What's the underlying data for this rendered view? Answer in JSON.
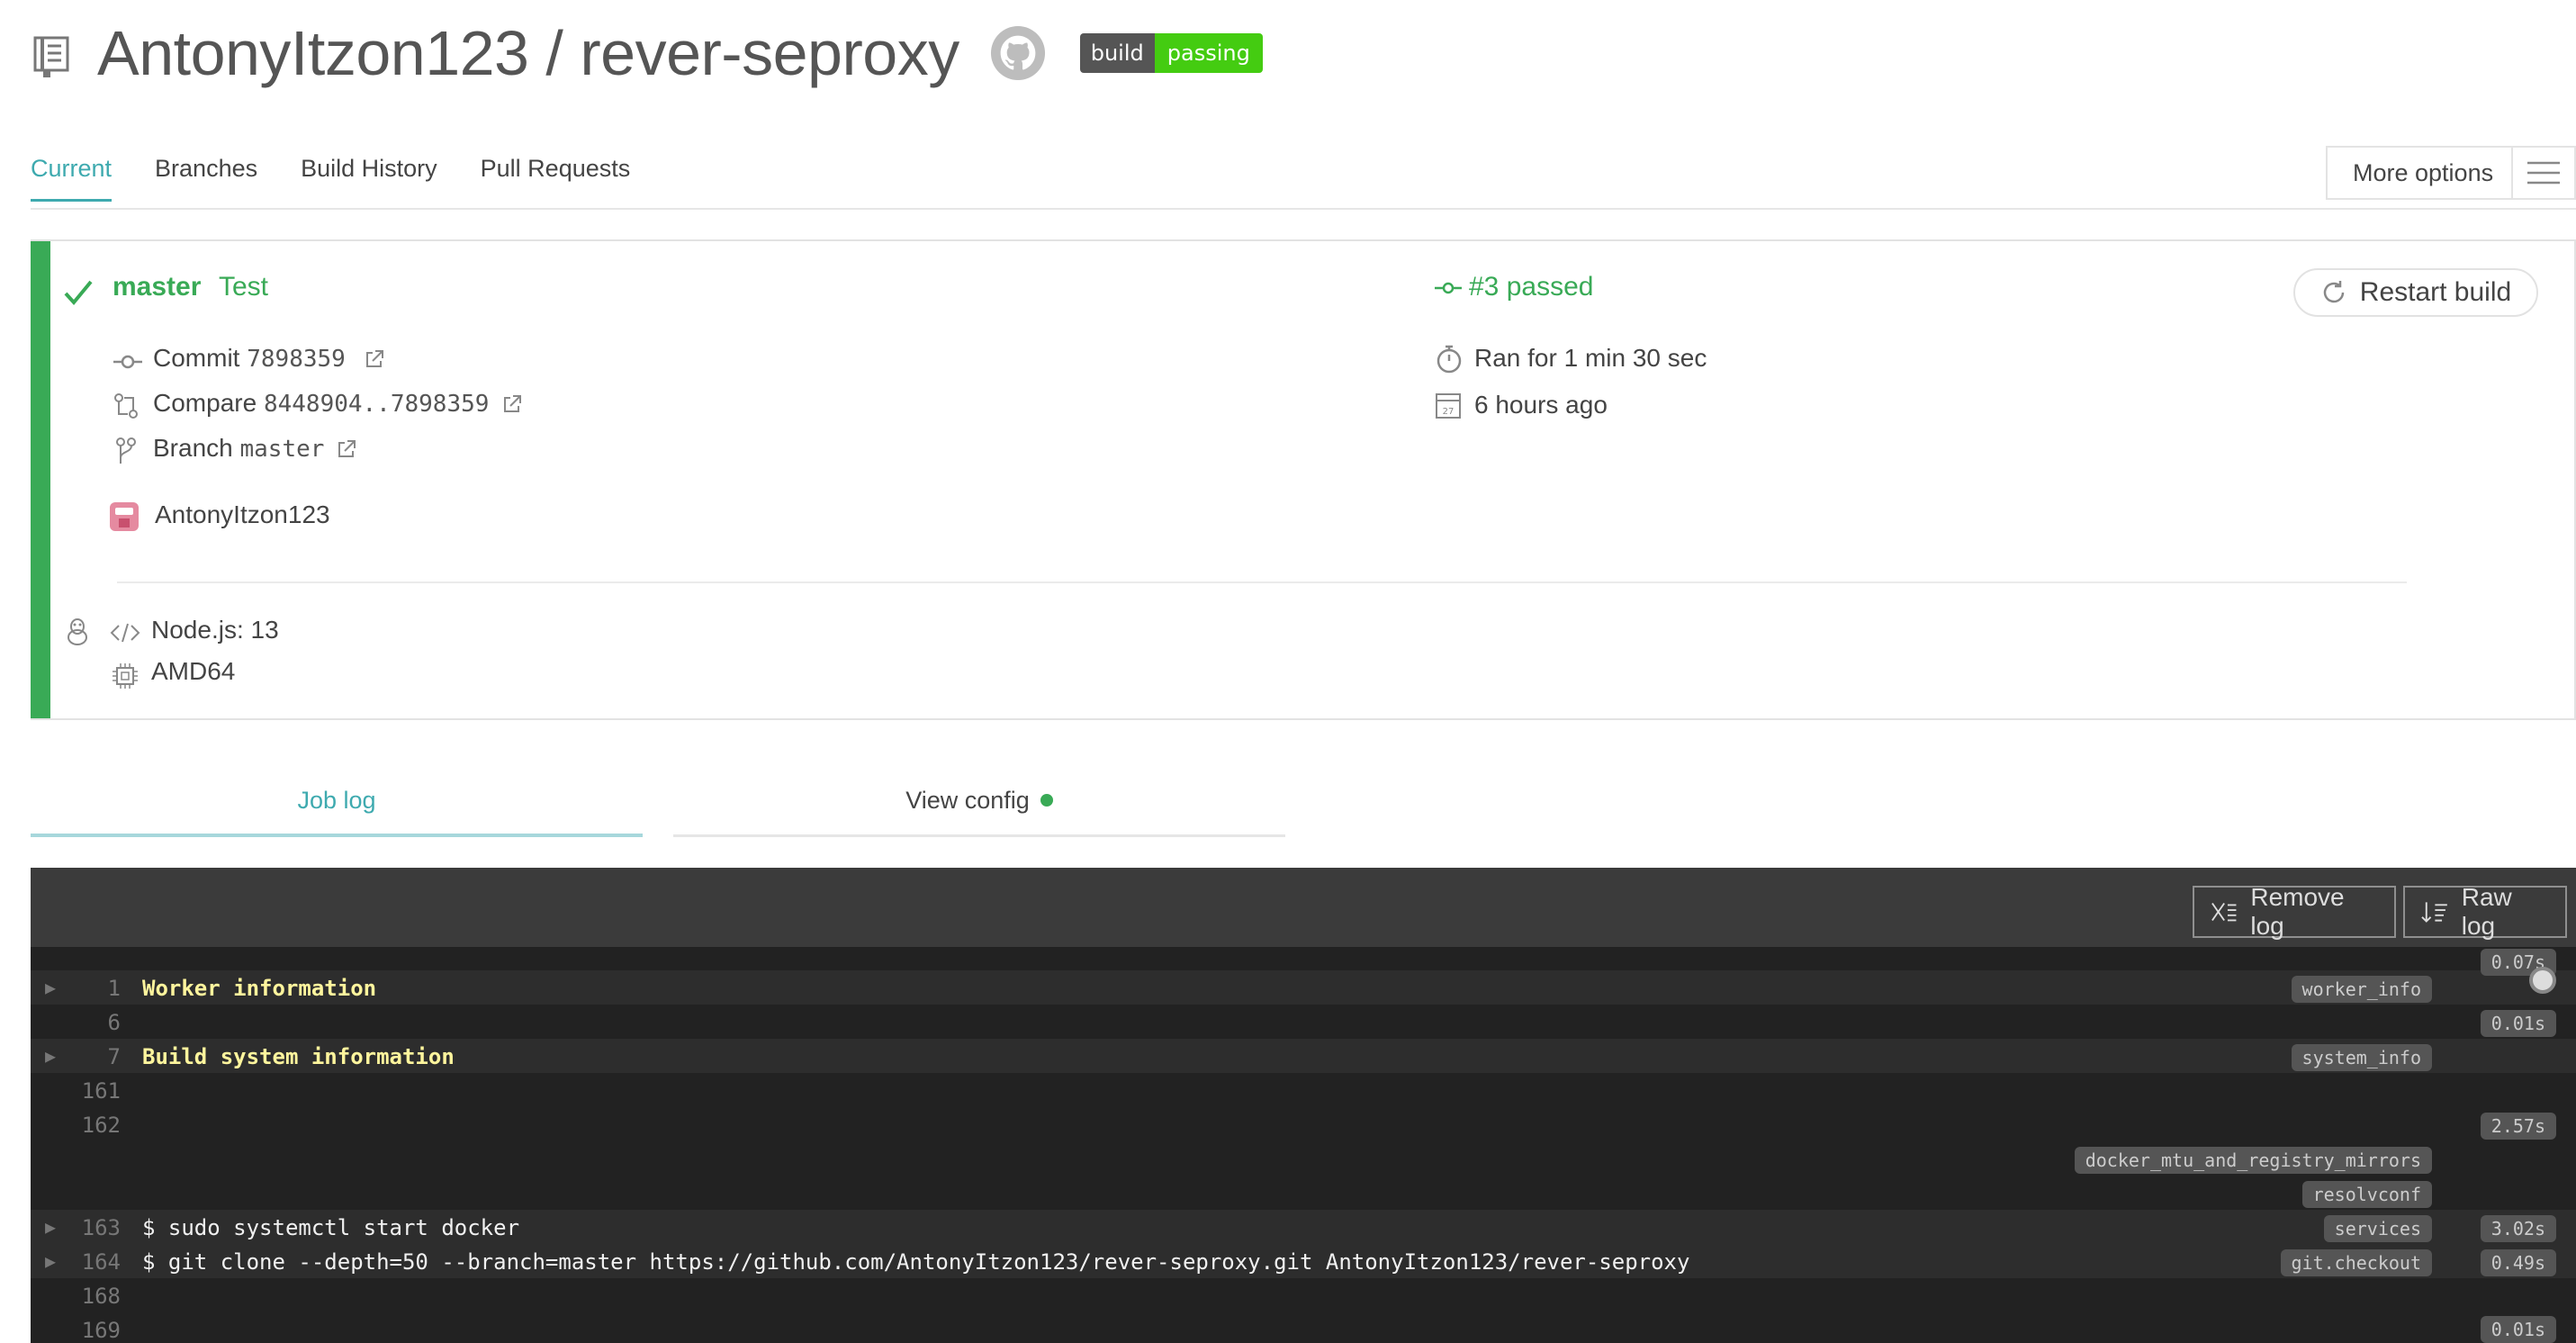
{
  "header": {
    "repo_title": "AntonyItzon123 / rever-seproxy",
    "badge": {
      "left": "build",
      "right": "passing"
    }
  },
  "tabs": [
    {
      "label": "Current",
      "active": true
    },
    {
      "label": "Branches"
    },
    {
      "label": "Build History"
    },
    {
      "label": "Pull Requests"
    }
  ],
  "more_options": {
    "label": "More options"
  },
  "build": {
    "branch": "master",
    "message": "Test",
    "status": "#3 passed",
    "commit_label": "Commit",
    "commit": "7898359",
    "compare_label": "Compare",
    "compare": "8448904..7898359",
    "branch_label": "Branch",
    "branch_value": "master",
    "author": "AntonyItzon123",
    "duration": "Ran for 1 min 30 sec",
    "finished": "6 hours ago",
    "restart_label": "Restart build",
    "language": "Node.js: 13",
    "arch": "AMD64",
    "calendar_day": "27"
  },
  "log_tabs": {
    "job_log": "Job log",
    "view_config": "View config"
  },
  "log_toolbar": {
    "remove": "Remove log",
    "raw": "Raw log"
  },
  "log_lines": [
    {
      "num": "1",
      "text": "Worker information",
      "style": "yellow",
      "fold": true
    },
    {
      "num": "6",
      "text": ""
    },
    {
      "num": "7",
      "text": "Build system information",
      "style": "yellow",
      "fold": true
    },
    {
      "num": "161",
      "text": ""
    },
    {
      "num": "162",
      "text": ""
    },
    {
      "num": "163",
      "text": "$ sudo systemctl start docker",
      "fold": true
    },
    {
      "num": "164",
      "text": "$ git clone --depth=50 --branch=master https://github.com/AntonyItzon123/rever-seproxy.git AntonyItzon123/rever-seproxy",
      "fold": true
    },
    {
      "num": "168",
      "text": ""
    },
    {
      "num": "169",
      "text": ""
    }
  ],
  "log_tags": {
    "worker_info": "worker_info",
    "system_info": "system_info",
    "docker_mtu": "docker_mtu_and_registry_mirrors",
    "resolvconf": "resolvconf",
    "services": "services",
    "git_checkout": "git.checkout"
  },
  "log_times": {
    "t0": "0.07s",
    "t1": "0.01s",
    "t2": "2.57s",
    "t3": "3.02s",
    "t4": "0.49s",
    "t5": "0.01s"
  },
  "colors": {
    "passed_green": "#39aa56",
    "teal_accent": "#3eaaaf",
    "log_bg": "#222222",
    "badge_green": "#44cc11"
  }
}
